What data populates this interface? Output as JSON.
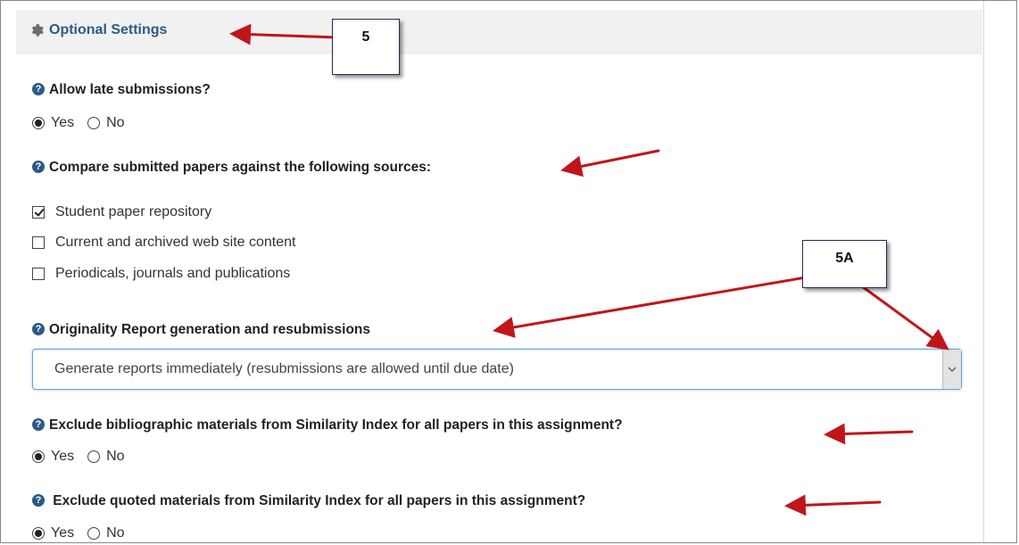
{
  "header": {
    "title": "Optional Settings",
    "icon": "gear-icon"
  },
  "late_submissions": {
    "question": "Allow late submissions?",
    "options": [
      "Yes",
      "No"
    ],
    "selected": "Yes"
  },
  "sources": {
    "question": "Compare submitted papers against the following sources:",
    "items": [
      {
        "label": "Student paper repository",
        "checked": true
      },
      {
        "label": "Current and archived web site content",
        "checked": false
      },
      {
        "label": "Periodicals, journals and publications",
        "checked": false
      }
    ]
  },
  "originality": {
    "question": "Originality Report generation and resubmissions",
    "selected_value": "Generate reports immediately (resubmissions are allowed until due date)"
  },
  "exclude_biblio": {
    "question": "Exclude bibliographic materials from Similarity Index for all papers in this assignment?",
    "options": [
      "Yes",
      "No"
    ],
    "selected": "Yes"
  },
  "exclude_quoted": {
    "question": " Exclude quoted materials from Similarity Index for all papers in this assignment?",
    "options": [
      "Yes",
      "No"
    ],
    "selected": "Yes"
  },
  "callouts": {
    "step5": "5",
    "step5a": "5A"
  },
  "help_icon_glyph": "?",
  "colors": {
    "header_text": "#2c5a86",
    "arrow": "#c0161b",
    "select_border": "#66a3d6"
  }
}
